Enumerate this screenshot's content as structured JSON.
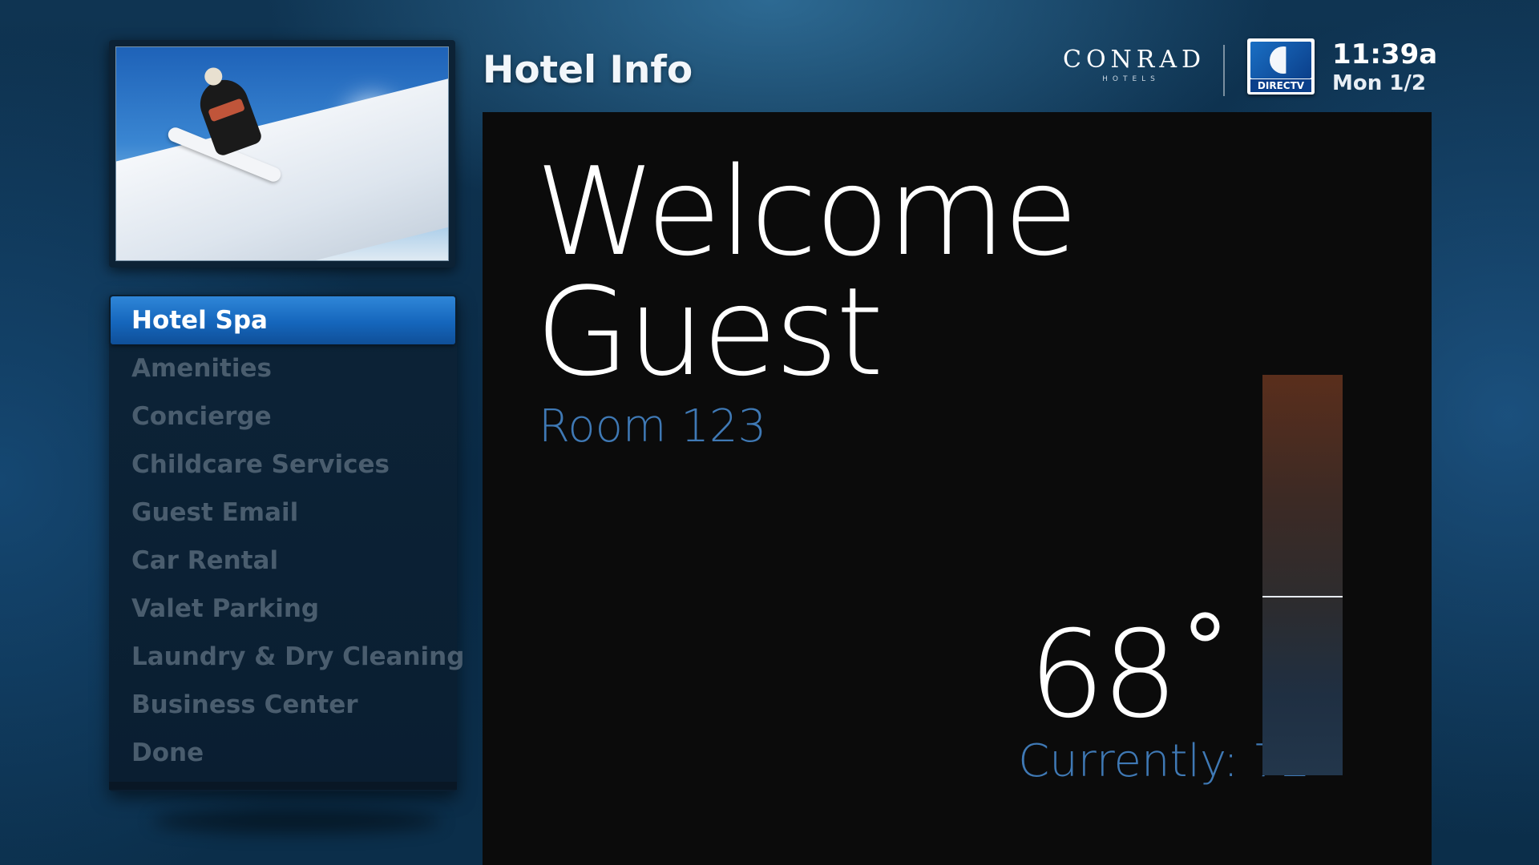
{
  "header": {
    "title": "Hotel Info",
    "brand_name": "CONRAD",
    "brand_sub": "HOTELS",
    "provider_logo_text": "DIRECTV",
    "clock_time": "11:39a",
    "clock_date": "Mon 1/2"
  },
  "preview": {
    "image_subject": "snowboarder mid-air jump"
  },
  "menu": {
    "items": [
      {
        "label": "Hotel Spa",
        "selected": true
      },
      {
        "label": "Amenities",
        "selected": false
      },
      {
        "label": "Concierge",
        "selected": false
      },
      {
        "label": "Childcare Services",
        "selected": false
      },
      {
        "label": "Guest Email",
        "selected": false
      },
      {
        "label": "Car Rental",
        "selected": false
      },
      {
        "label": "Valet Parking",
        "selected": false
      },
      {
        "label": "Laundry & Dry Cleaning",
        "selected": false
      },
      {
        "label": "Business Center",
        "selected": false
      },
      {
        "label": "Done",
        "selected": false
      }
    ]
  },
  "main": {
    "welcome_line1": "Welcome",
    "welcome_line2": "Guest",
    "room": "Room 123",
    "set_temperature": "68˚",
    "current_temperature": "Currently: 72˚"
  },
  "colors": {
    "accent_blue": "#3f79b5",
    "menu_selected": "#1566bc",
    "panel_bg": "#0b0b0b"
  }
}
